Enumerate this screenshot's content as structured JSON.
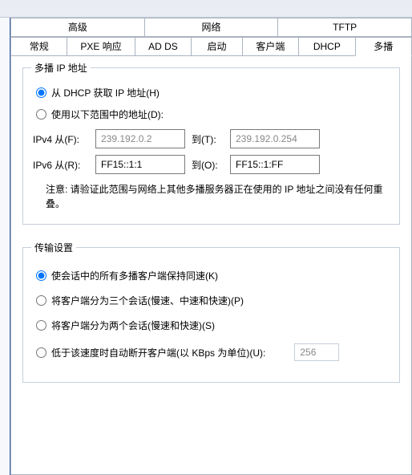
{
  "tabsRow1": {
    "advanced": "高级",
    "network": "网络",
    "tftp": "TFTP"
  },
  "tabsRow2": {
    "general": "常规",
    "pxe": "PXE 响应",
    "adds": "AD DS",
    "boot": "启动",
    "client": "客户端",
    "dhcp": "DHCP",
    "multicast": "多播"
  },
  "multicast_group": {
    "title": "多播 IP 地址",
    "opt_dhcp": "从 DHCP 获取 IP 地址(H)",
    "opt_range": "使用以下范围中的地址(D):",
    "ipv4_from_label": "IPv4   从(F):",
    "ipv4_from_value": "239.192.0.2",
    "ipv4_to_label": "到(T):",
    "ipv4_to_value": "239.192.0.254",
    "ipv6_from_label": "IPv6   从(R):",
    "ipv6_from_value": "FF15::1:1",
    "ipv6_to_label": "到(O):",
    "ipv6_to_value": "FF15::1:FF",
    "note": "注意: 请验证此范围与网络上其他多播服务器正在使用的 IP 地址之间没有任何重叠。"
  },
  "transfer_group": {
    "title": "传输设置",
    "opt_sync": "使会话中的所有多播客户端保持同速(K)",
    "opt_three": "将客户端分为三个会话(慢速、中速和快速)(P)",
    "opt_two": "将客户端分为两个会话(慢速和快速)(S)",
    "opt_kbps": "低于该速度时自动断开客户端(以 KBps 为单位)(U):",
    "kbps_value": "256"
  }
}
